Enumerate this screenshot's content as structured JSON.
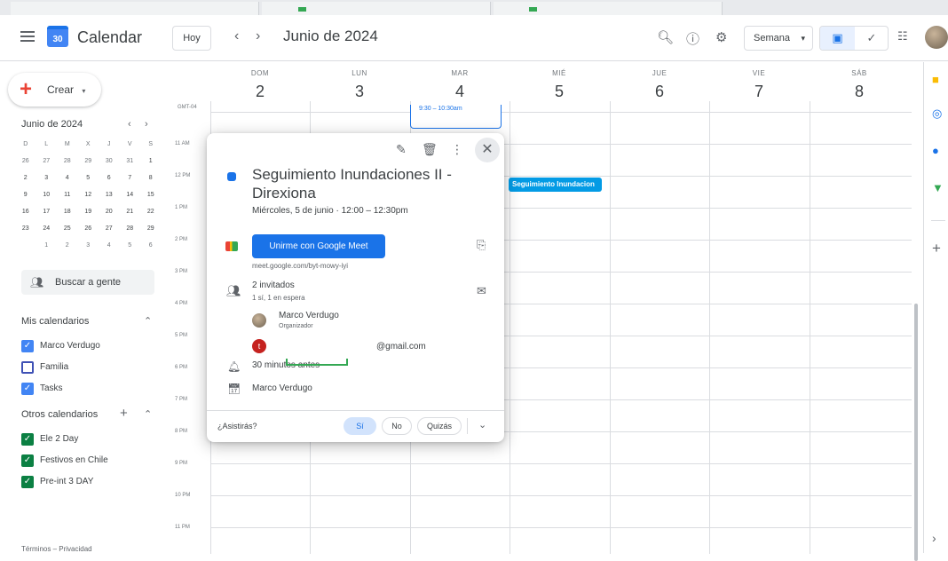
{
  "app": {
    "name": "Calendar",
    "logo_day": "30"
  },
  "header": {
    "today_label": "Hoy",
    "prev_icon": "‹",
    "next_icon": "›",
    "month_title": "Junio de 2024",
    "view_label": "Semana",
    "view_arrow": "▾"
  },
  "sidebar": {
    "create_label": "Crear",
    "create_arrow": "▾",
    "mini_month": "Junio de 2024",
    "mini_weekdays": [
      "D",
      "L",
      "M",
      "X",
      "J",
      "V",
      "S"
    ],
    "mini_weeks": [
      [
        "26",
        "27",
        "28",
        "29",
        "30",
        "31",
        "1"
      ],
      [
        "2",
        "3",
        "4",
        "5",
        "6",
        "7",
        "8"
      ],
      [
        "9",
        "10",
        "11",
        "12",
        "13",
        "14",
        "15"
      ],
      [
        "16",
        "17",
        "18",
        "19",
        "20",
        "21",
        "22"
      ],
      [
        "23",
        "24",
        "25",
        "26",
        "27",
        "28",
        "29"
      ],
      [
        "30",
        "1",
        "2",
        "3",
        "4",
        "5",
        "6"
      ]
    ],
    "people_search": "Buscar a gente",
    "my_calendars_title": "Mis calendarios",
    "my_calendars": [
      {
        "label": "Marco Verdugo",
        "checked": true,
        "color": "#4285f4"
      },
      {
        "label": "Familia",
        "checked": false,
        "color": "#3f51b5"
      },
      {
        "label": "Tasks",
        "checked": true,
        "color": "#4285f4"
      }
    ],
    "other_calendars_title": "Otros calendarios",
    "other_calendars": [
      {
        "label": "Ele 2 Day",
        "checked": true,
        "color": "#0b8043"
      },
      {
        "label": "Festivos en Chile",
        "checked": true,
        "color": "#0b8043"
      },
      {
        "label": "Pre-int 3 DAY",
        "checked": true,
        "color": "#0b8043"
      }
    ],
    "footer": "Términos – Privacidad"
  },
  "week": {
    "timezone": "GMT-04",
    "days": [
      {
        "name": "DOM",
        "date": "2"
      },
      {
        "name": "LUN",
        "date": "3"
      },
      {
        "name": "MAR",
        "date": "4"
      },
      {
        "name": "MIÉ",
        "date": "5"
      },
      {
        "name": "JUE",
        "date": "6"
      },
      {
        "name": "VIE",
        "date": "7"
      },
      {
        "name": "SÁB",
        "date": "8"
      }
    ],
    "hours": [
      "11 AM",
      "12 PM",
      "1 PM",
      "2 PM",
      "3 PM",
      "4 PM",
      "5 PM",
      "6 PM",
      "7 PM",
      "8 PM",
      "9 PM",
      "10 PM",
      "11 PM"
    ],
    "top_event_time": "9:30 – 10:30am",
    "event_chip": "Seguimiento Inundacion"
  },
  "popup": {
    "title": "Seguimiento Inundaciones II - Direxiona",
    "date": "Miércoles, 5 de junio  ·  12:00 – 12:30pm",
    "meet_button": "Unirme con Google Meet",
    "meet_link": "meet.google.com/byt-mowy-iyi",
    "guests_count": "2 invitados",
    "guests_summary": "1 sí, 1 en espera",
    "guest1_name": "Marco Verdugo",
    "guest1_role": "Organizador",
    "guest2_initial": "t",
    "guest2_email": "@gmail.com",
    "reminder": "30 minutos antes",
    "owner": "Marco Verdugo",
    "rsvp_question": "¿Asistirás?",
    "rsvp_yes": "Sí",
    "rsvp_no": "No",
    "rsvp_maybe": "Quizás"
  },
  "colors": {
    "accent": "#1a73e8",
    "event": "#039be5",
    "create_plus": "#ea4335",
    "annotation": "#34a853"
  }
}
